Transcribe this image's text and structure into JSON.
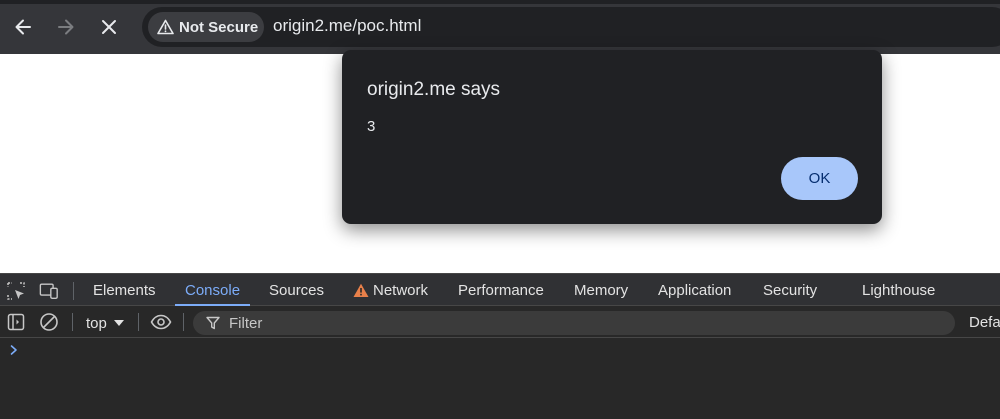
{
  "browser": {
    "security_label": "Not Secure",
    "url": "origin2.me/poc.html"
  },
  "dialog": {
    "title": "origin2.me says",
    "message": "3",
    "ok_label": "OK"
  },
  "devtools": {
    "tabs": [
      {
        "label": "Elements"
      },
      {
        "label": "Console",
        "active": true
      },
      {
        "label": "Sources"
      },
      {
        "label": "Network",
        "warning": true
      },
      {
        "label": "Performance"
      },
      {
        "label": "Memory"
      },
      {
        "label": "Application"
      },
      {
        "label": "Security"
      },
      {
        "label": "Lighthouse"
      }
    ],
    "console": {
      "context": "top",
      "filter_placeholder": "Filter",
      "levels_label": "Defa"
    }
  },
  "colors": {
    "accent": "#7cacf8",
    "ok_button": "#a8c7fa",
    "warning": "#e8804a"
  },
  "icons": [
    "back-arrow-icon",
    "forward-arrow-icon",
    "stop-icon",
    "warning-triangle-icon",
    "inspect-element-icon",
    "device-toolbar-icon",
    "sidebar-toggle-icon",
    "clear-console-icon",
    "chevron-down-icon",
    "eye-icon",
    "filter-icon",
    "prompt-chevron-icon"
  ]
}
